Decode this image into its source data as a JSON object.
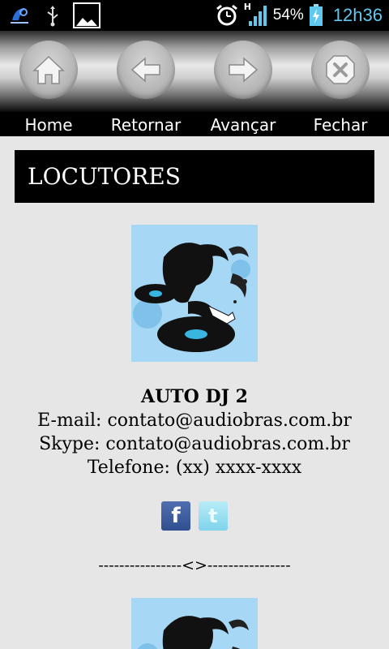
{
  "status_bar": {
    "network_type": "H",
    "battery_percent": "54%",
    "time": "12h36"
  },
  "toolbar": {
    "home_label": "Home",
    "back_label": "Retornar",
    "forward_label": "Avançar",
    "close_label": "Fechar"
  },
  "section": {
    "title": "LOCUTORES"
  },
  "announcers": [
    {
      "name": "AUTO DJ 2",
      "email": "E-mail: contato@audiobras.com.br",
      "skype": "Skype: contato@audiobras.com.br",
      "phone": "Telefone: (xx) xxxx-xxxx"
    }
  ],
  "social": {
    "facebook_glyph": "f",
    "twitter_glyph": "t"
  },
  "separator": "----------------<>----------------",
  "colors": {
    "accent": "#5ec8ee",
    "photo_bg": "#a6d7f4",
    "header_bg": "#000000",
    "page_bg": "#e6e6e6"
  }
}
